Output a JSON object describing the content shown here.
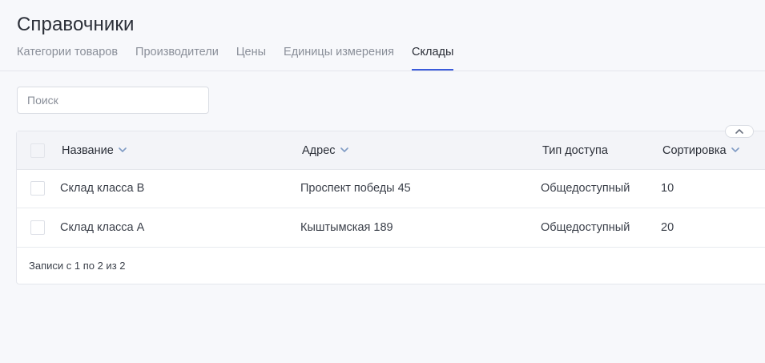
{
  "header": {
    "title": "Справочники"
  },
  "tabs": [
    {
      "label": "Категории товаров",
      "active": false
    },
    {
      "label": "Производители",
      "active": false
    },
    {
      "label": "Цены",
      "active": false
    },
    {
      "label": "Единицы измерения",
      "active": false
    },
    {
      "label": "Склады",
      "active": true
    }
  ],
  "search": {
    "placeholder": "Поиск",
    "value": ""
  },
  "table": {
    "columns": {
      "name": "Название",
      "address": "Адрес",
      "access_type": "Тип доступа",
      "sorting": "Сортировка"
    },
    "rows": [
      {
        "name": "Склад класса B",
        "address": "Проспект победы 45",
        "access_type": "Общедоступный",
        "sorting": "10"
      },
      {
        "name": "Склад класса А",
        "address": "Кыштымская 189",
        "access_type": "Общедоступный",
        "sorting": "20"
      }
    ],
    "footer": "Записи с 1 по 2 из 2"
  },
  "icons": {
    "sort": "chevron-down-icon",
    "collapse": "chevron-up-icon"
  },
  "colors": {
    "accent": "#3b5bdb",
    "chevron": "#7f9bc4",
    "background": "#f7f8fb"
  }
}
